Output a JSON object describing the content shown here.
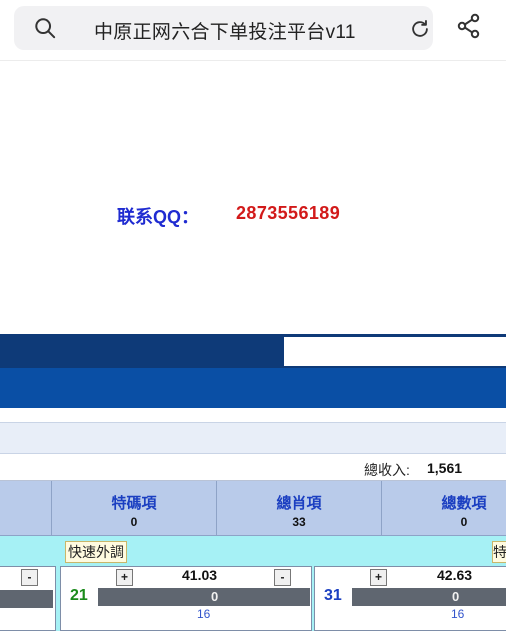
{
  "browser": {
    "url_text": "中原正网六合下单投注平台v11",
    "icons": {
      "search": "search-icon",
      "reload": "reload-icon",
      "share": "share-icon"
    }
  },
  "contact": {
    "label": "联系QQ：",
    "value": "2873556189",
    "label_color": "#1f2bd1",
    "value_color": "#d21a1a"
  },
  "summary": {
    "income_label": "總收入:",
    "income_value": "1,561"
  },
  "categories": [
    {
      "title": "特碼項",
      "count": "0"
    },
    {
      "title": "總肖項",
      "count": "33"
    },
    {
      "title": "總數項",
      "count": "0"
    }
  ],
  "quick": {
    "label": "快速外調",
    "right_label": "特"
  },
  "items": [
    {
      "plus": "+",
      "minus": "-",
      "number": "",
      "odds": "",
      "bar_value": "",
      "sub_value": ""
    },
    {
      "plus": "+",
      "minus": "-",
      "number": "21",
      "odds": "41.03",
      "bar_value": "0",
      "sub_value": "16"
    },
    {
      "plus": "+",
      "minus": "-",
      "number": "31",
      "odds": "42.63",
      "bar_value": "0",
      "sub_value": "16"
    }
  ],
  "colors": {
    "navy_band": "#0e3a78",
    "blue_band": "#0a4fa5",
    "header_bg": "#b9cbea",
    "cyan_bg": "#a6f1f5",
    "number_green": "#1a8a1a",
    "number_blue": "#1b3fc1"
  }
}
